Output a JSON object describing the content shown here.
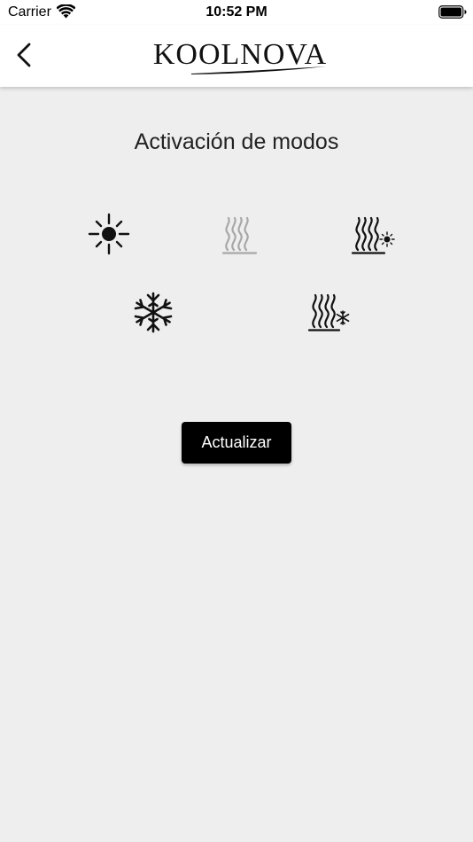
{
  "status_bar": {
    "carrier": "Carrier",
    "time": "10:52 PM",
    "icons": [
      "wifi-icon",
      "battery-icon"
    ]
  },
  "nav": {
    "back_icon": "chevron-left-icon",
    "logo_text": "KOOLNOVA"
  },
  "page": {
    "title": "Activación de modos"
  },
  "modes": [
    {
      "icon": "sun-icon",
      "state": "active"
    },
    {
      "icon": "heat-waves-icon",
      "state": "inactive"
    },
    {
      "icon": "heat-waves-sun-icon",
      "state": "active"
    },
    {
      "icon": "snowflake-icon",
      "state": "active"
    },
    {
      "icon": "heat-waves-snowflake-icon",
      "state": "active"
    }
  ],
  "colors": {
    "background": "#eeeeee",
    "header": "#ffffff",
    "active_icon": "#111111",
    "inactive_icon": "#a8a8a8",
    "button": "#000000",
    "button_text": "#ffffff"
  },
  "actions": {
    "update_label": "Actualizar"
  }
}
